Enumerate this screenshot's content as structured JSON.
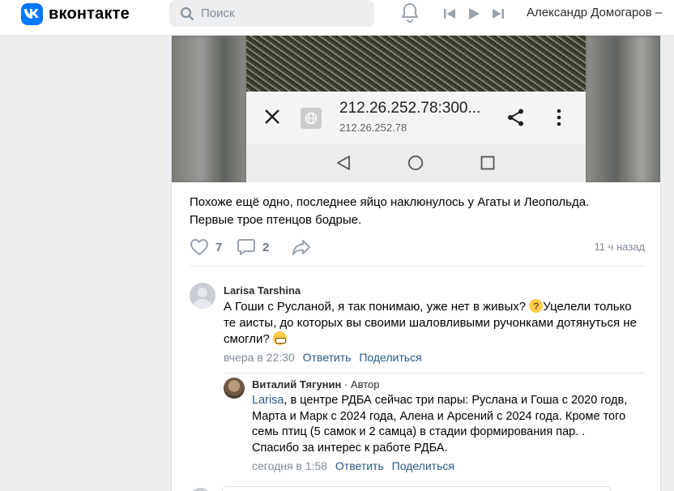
{
  "header": {
    "logo_text": "вконтакте",
    "search_placeholder": "Поиск",
    "user_name": "Александр Домогаров –"
  },
  "phone": {
    "url": "212.26.252.78:300...",
    "url_sub": "212.26.252.78"
  },
  "post": {
    "text_line1": "Похоже ещё одно, последнее яйцо наклюнулось у Агаты и Леопольда.",
    "text_line2": "Первые трое птенцов бодрые.",
    "likes": "7",
    "comments": "2",
    "time": "11 ч назад"
  },
  "comments": [
    {
      "author": "Larisa Tarshina",
      "text_part1": "А Гоши с Русланой, я так понимаю, уже нет в живых? ",
      "text_part2": "Уцелели только те аисты, до которых вы своими шаловливыми ручонками дотянуться не смогли? ",
      "time": "вчера в 22:30",
      "reply_label": "Ответить",
      "share_label": "Поделиться"
    },
    {
      "author": "Виталий Тягунин",
      "author_role": " · Автор",
      "mention": "Larisa",
      "text": ", в центре РДБА сейчас три пары: Руслана и Гоша с 2020 годв, Марта и Марк с 2024 года, Алена и Арсений с 2024 года. Кроме того семь птиц (5 самок и 2 самца) в стадии формирования пар. .",
      "text_line2": "Спасибо за интерес к работе РДБА.",
      "time": "сегодня в 1:58",
      "reply_label": "Ответить",
      "share_label": "Поделиться"
    }
  ],
  "colors": {
    "brand": "#0077ff",
    "link": "#2a5885",
    "muted": "#818c99",
    "background": "#edeef0"
  },
  "icons": [
    "vk-logo-icon",
    "search-icon",
    "bell-icon",
    "prev-track-icon",
    "play-icon",
    "next-track-icon",
    "close-icon",
    "globe-icon",
    "share-icon",
    "more-icon",
    "nav-back-icon",
    "nav-home-icon",
    "nav-recent-icon",
    "heart-icon",
    "comment-icon",
    "repost-icon"
  ]
}
